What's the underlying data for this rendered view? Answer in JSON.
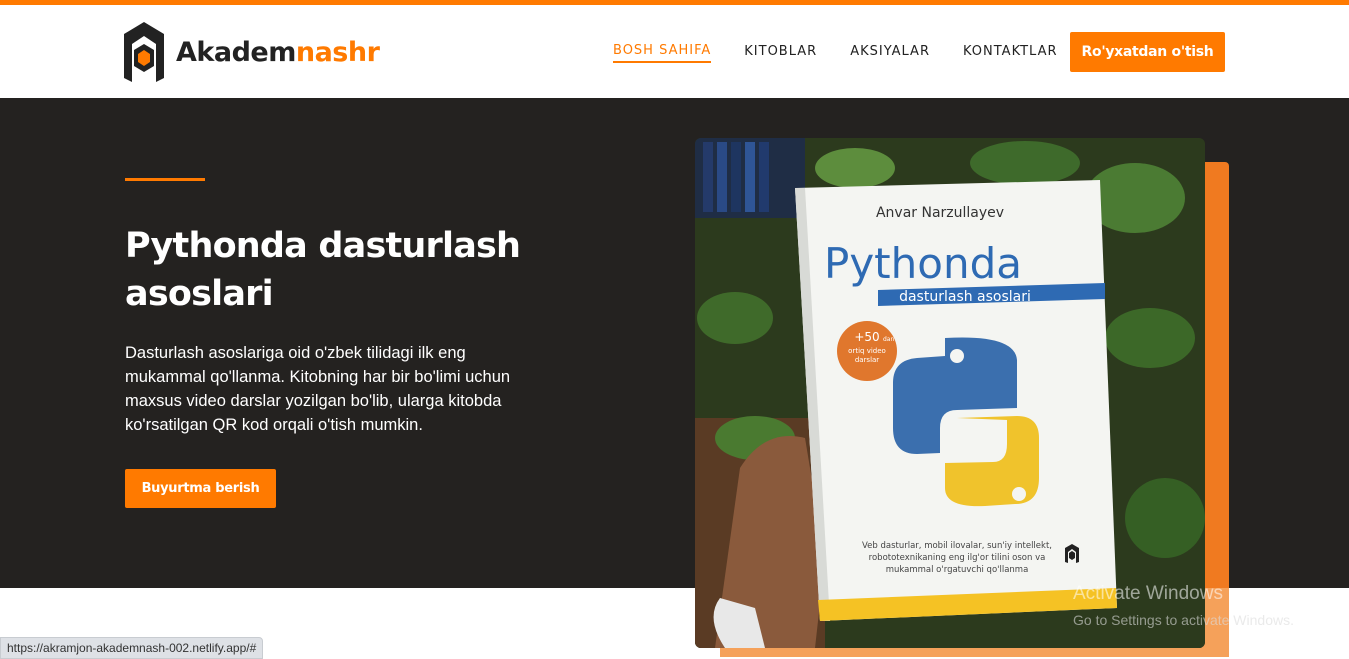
{
  "header": {
    "logo": {
      "text_dark": "Akadem",
      "text_orange": "nashr"
    },
    "nav": [
      {
        "label": "BOSH SAHIFA",
        "active": true
      },
      {
        "label": "KITOBLAR",
        "active": false
      },
      {
        "label": "AKSIYALAR",
        "active": false
      },
      {
        "label": "KONTAKTLAR",
        "active": false
      }
    ],
    "register_label": "Ro'yxatdan o'tish"
  },
  "hero": {
    "title": "Pythonda dasturlash asoslari",
    "description": "Dasturlash asoslariga oid o'zbek tilidagi ilk eng mukammal qo'llanma. Kitobning har bir bo'limi uchun maxsus video darslar yozilgan bo'lib, ularga kitobda ko'rsatilgan QR kod orqali o'tish mumkin.",
    "order_label": "Buyurtma berish"
  },
  "book": {
    "author": "Anvar Narzullayev",
    "title": "Pythonda",
    "subtitle": "dasturlash asoslari",
    "badge": [
      "+50",
      "dan",
      "ortiq video",
      "darslar"
    ],
    "tagline": [
      "Veb dasturlar, mobil ilovalar, sun'iy intellekt,",
      "robototexnikaning eng ilg'or tilini oson va",
      "mukammal o'rgatuvchi qo'llanma"
    ]
  },
  "status_bar": {
    "url": "https://akramjon-akademnash-002.netlify.app/#"
  },
  "watermark": {
    "title": "Activate Windows",
    "subtitle": "Go to Settings to activate Windows."
  },
  "colors": {
    "accent": "#ff7a00",
    "hero_bg": "#242220",
    "text_dark": "#222222"
  }
}
